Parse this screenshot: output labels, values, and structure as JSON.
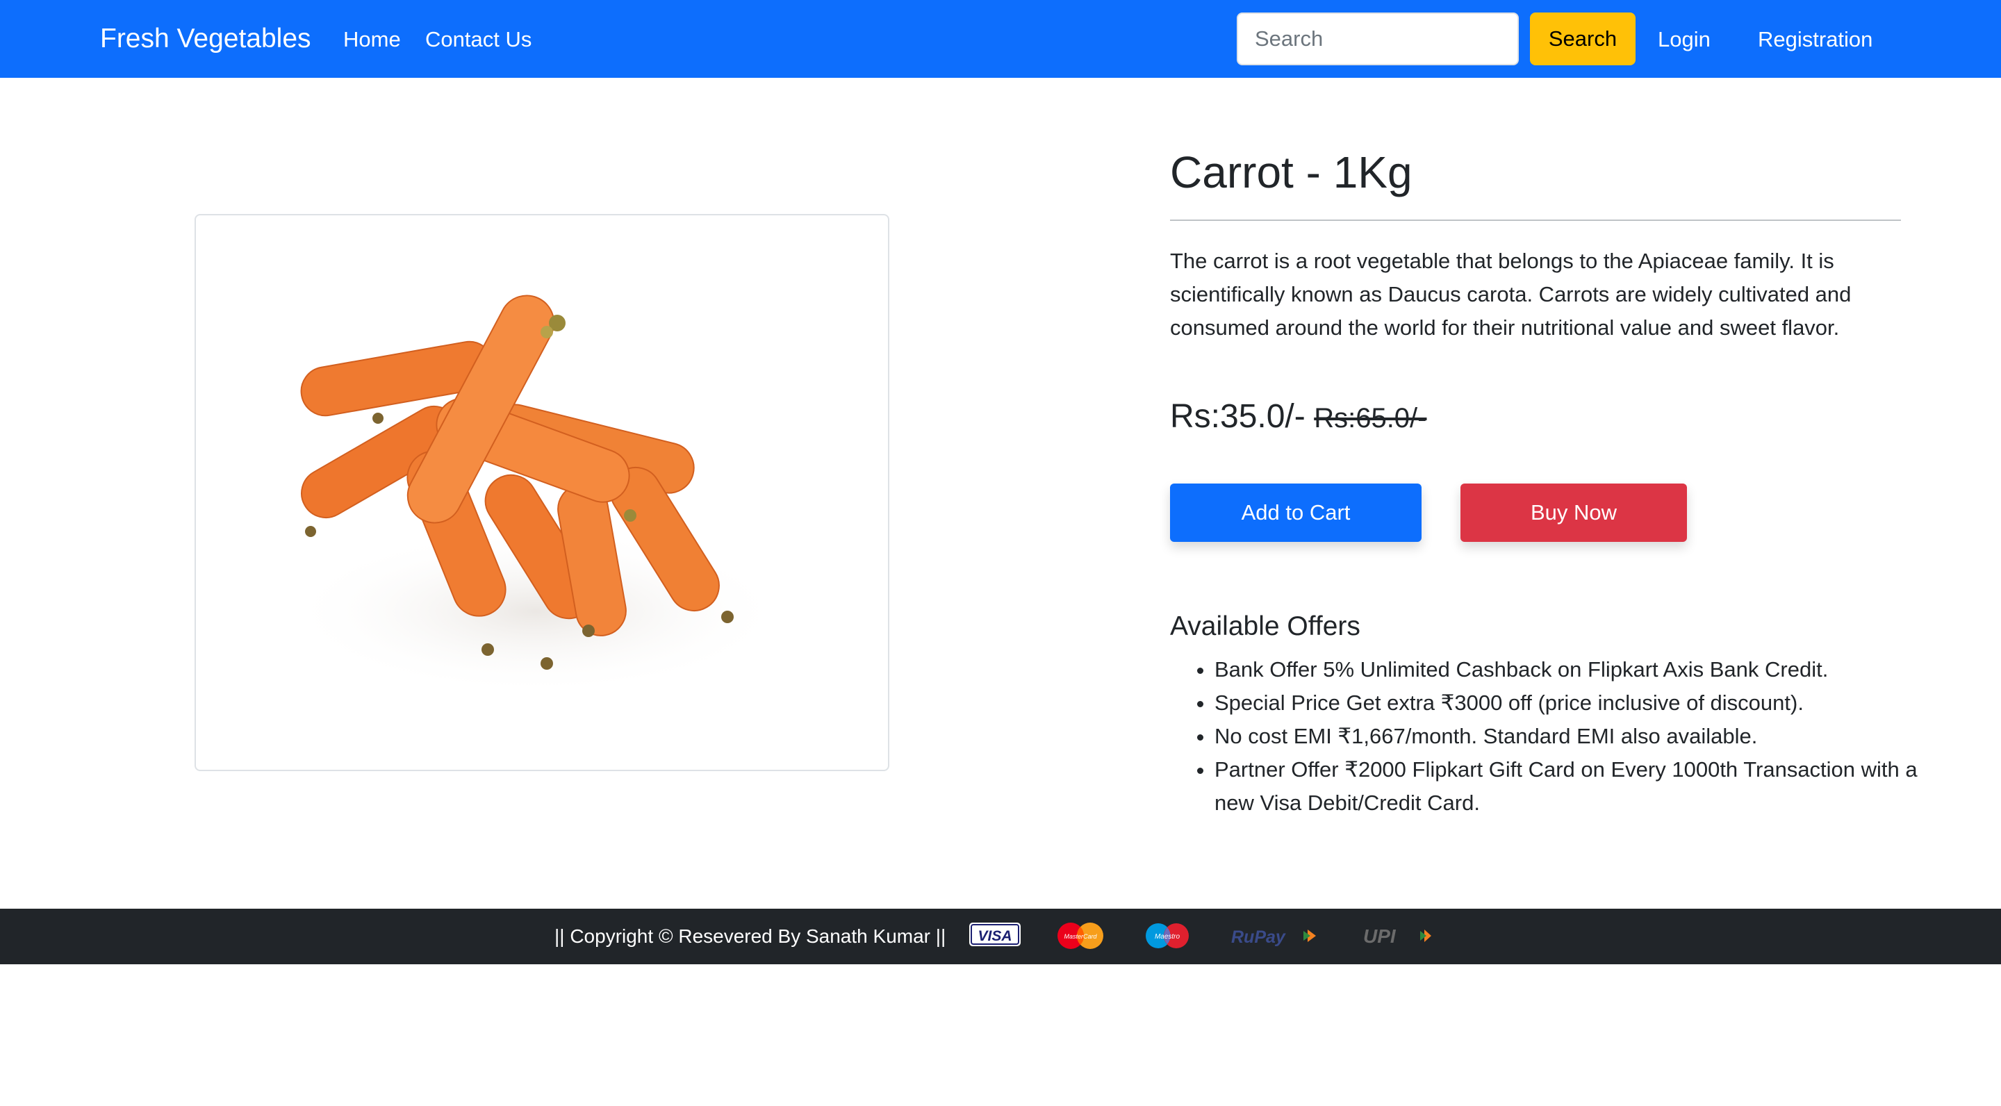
{
  "navbar": {
    "brand": "Fresh Vegetables",
    "links": [
      "Home",
      "Contact Us"
    ],
    "search_placeholder": "Search",
    "search_button": "Search",
    "login": "Login",
    "registration": "Registration"
  },
  "product": {
    "title": "Carrot - 1Kg",
    "description": "The carrot is a root vegetable that belongs to the Apiaceae family. It is scientifically known as Daucus carota. Carrots are widely cultivated and consumed around the world for their nutritional value and sweet flavor.",
    "price": "Rs:35.0/-",
    "old_price": "Rs:65.0/-",
    "add_to_cart": "Add to Cart",
    "buy_now": "Buy Now"
  },
  "offers": {
    "title": "Available Offers",
    "items": [
      "Bank Offer 5% Unlimited Cashback on Flipkart Axis Bank Credit.",
      "Special Price Get extra ₹3000 off (price inclusive of discount).",
      "No cost EMI ₹1,667/month. Standard EMI also available.",
      "Partner Offer ₹2000 Flipkart Gift Card on Every 1000th Transaction with a new Visa Debit/Credit Card."
    ]
  },
  "footer": {
    "copyright": "|| Copyright © Resevered By Sanath Kumar ||",
    "payment_logos": [
      "VISA",
      "MasterCard",
      "Maestro",
      "RuPay",
      "UPI"
    ]
  },
  "colors": {
    "navbar": "#0d6efd",
    "search_button": "#ffc107",
    "add_to_cart": "#0d6efd",
    "buy_now": "#dc3545",
    "footer": "#212529",
    "carrot": "#f07a32"
  }
}
